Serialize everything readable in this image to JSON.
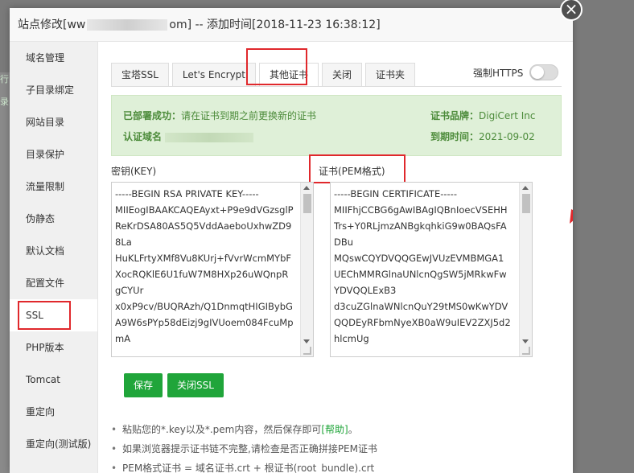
{
  "dialog": {
    "title_prefix": "站点修改[ww",
    "title_suffix": "om] -- 添加时间[2018-11-23 16:38:12]",
    "close_icon": "close-icon"
  },
  "background": {
    "strip_texts": [
      "行",
      "录"
    ]
  },
  "sidebar": {
    "items": [
      {
        "label": "域名管理"
      },
      {
        "label": "子目录绑定"
      },
      {
        "label": "网站目录"
      },
      {
        "label": "目录保护"
      },
      {
        "label": "流量限制"
      },
      {
        "label": "伪静态"
      },
      {
        "label": "默认文档"
      },
      {
        "label": "配置文件"
      },
      {
        "label": "SSL"
      },
      {
        "label": "PHP版本"
      },
      {
        "label": "Tomcat"
      },
      {
        "label": "重定向"
      },
      {
        "label": "重定向(测试版)"
      }
    ],
    "active": "SSL"
  },
  "tabs": [
    {
      "label": "宝塔SSL"
    },
    {
      "label": "Let's Encrypt"
    },
    {
      "label": "其他证书"
    },
    {
      "label": "关闭"
    },
    {
      "label": "证书夹"
    }
  ],
  "active_tab": "其他证书",
  "https": {
    "label": "强制HTTPS",
    "enabled": false
  },
  "info": {
    "status_label": "已部署成功：",
    "status_text": "请在证书到期之前更换新的证书",
    "domain_label": "认证域名",
    "brand_label": "证书品牌：",
    "brand_value": "DigiCert Inc",
    "expire_label": "到期时间：",
    "expire_value": "2021-09-02"
  },
  "key_field": {
    "label": "密钥(KEY)",
    "lines": [
      "-----BEGIN RSA PRIVATE KEY-----",
      "MIIEogIBAAKCAQEAyxt+P9e9dVGzsglP",
      "ReKrDSA80AS5Q5VddAaeboUxhwZD9",
      "8La",
      "HuKLFrtyXMf8Vu8KUrj+fVvrWcmMYbF",
      "XocRQKlE6U1fuW7M8HXp26uWQnpR",
      "gCYUr",
      "x0xP9cv/BUQRAzh/Q1DnmqtHIGIBybG",
      "A9W6sPYp58dEizj9gIVUoem084FcuMp",
      "mA"
    ]
  },
  "cert_field": {
    "label": "证书(PEM格式)",
    "lines": [
      "-----BEGIN CERTIFICATE-----",
      "MIIFhjCCBG6gAwIBAgIQBnIoecVSEHH",
      "Trs+Y0RLjmzANBgkqhkiG9w0BAQsFA",
      "DBu",
      "MQswCQYDVQQGEwJVUzEVMBMGA1",
      "UEChMMRGlnaUNlcnQgSW5jMRkwFw",
      "YDVQQLExB3",
      "d3cuZGlnaWNlcnQuY29tMS0wKwYDV",
      "QQDEyRFbmNyeXB0aW9uIEV2ZXJ5d2",
      "hlcmUg"
    ]
  },
  "buttons": {
    "save": "保存",
    "close_ssl": "关闭SSL"
  },
  "tips": {
    "tip1_prefix": "粘贴您的*.key以及*.pem内容，然后保存即可",
    "tip1_link": "[帮助]",
    "tip1_suffix": "。",
    "tip2": "如果浏览器提示证书链不完整,请检查是否正确拼接PEM证书",
    "tip3": "PEM格式证书 = 域名证书.crt + 根证书(root_bundle).crt"
  },
  "colors": {
    "accent": "#20a53a",
    "highlight": "#e0282c",
    "info_bg": "#dff0d8"
  }
}
